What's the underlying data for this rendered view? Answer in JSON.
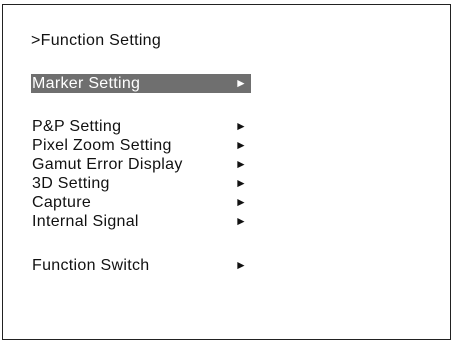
{
  "menu": {
    "title": ">Function Setting",
    "arrow_icon": "right-triangle-icon",
    "selected_color": "#6f6f6f",
    "items": [
      {
        "label": "Marker Setting",
        "arrow": "►",
        "selected": true
      },
      {
        "label": "P&P Setting",
        "arrow": "►",
        "selected": false
      },
      {
        "label": "Pixel Zoom Setting",
        "arrow": "►",
        "selected": false
      },
      {
        "label": "Gamut Error Display",
        "arrow": "►",
        "selected": false
      },
      {
        "label": "3D Setting",
        "arrow": "►",
        "selected": false
      },
      {
        "label": "Capture",
        "arrow": "►",
        "selected": false
      },
      {
        "label": "Internal Signal",
        "arrow": "►",
        "selected": false
      },
      {
        "label": "Function Switch",
        "arrow": "►",
        "selected": false
      }
    ]
  }
}
